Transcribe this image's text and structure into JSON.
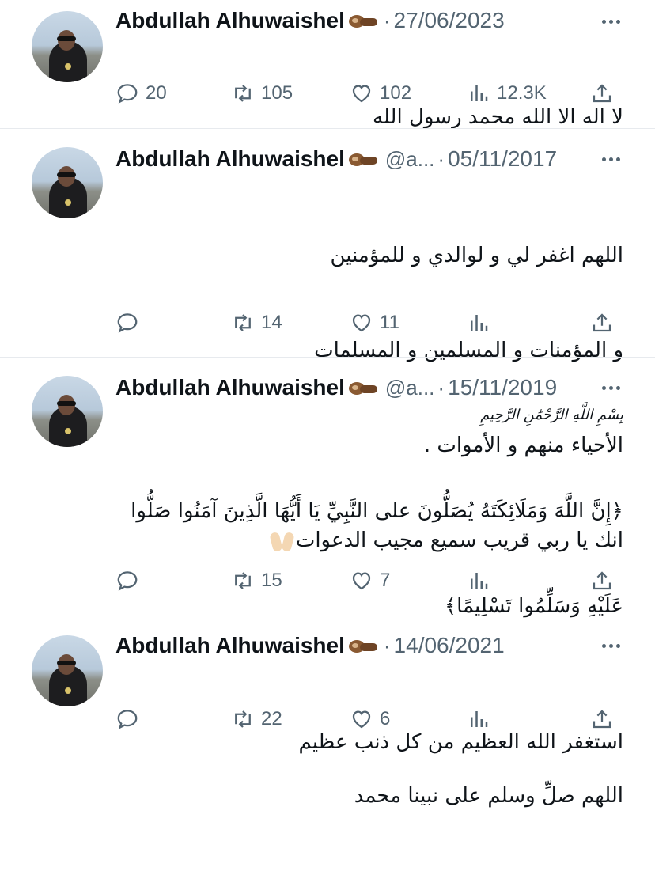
{
  "tweets": [
    {
      "name": "Abdullah Alhuwaishel",
      "handle": "",
      "date": "27/06/2023",
      "lines": [
        "لا اله الا الله محمد رسول الله"
      ],
      "replies": "20",
      "retweets": "105",
      "likes": "102",
      "views": "12.3K"
    },
    {
      "name": "Abdullah Alhuwaishel",
      "handle": "@a...",
      "date": "05/11/2017",
      "lines": [
        "اللهم اغفر لي و لوالدي و للمؤمنين",
        "و المؤمنات و المسلمين و المسلمات",
        "الأحياء منهم و الأموات .",
        "انك يا ربي قريب سميع مجيب الدعوات"
      ],
      "replies": "",
      "retweets": "14",
      "likes": "11",
      "views": ""
    },
    {
      "name": "Abdullah Alhuwaishel",
      "handle": "@a...",
      "date": "15/11/2019",
      "bismillah": "بِسْمِ اللَّهِ الرَّحْمَٰنِ الرَّحِيمِ",
      "lines": [
        "﴿إِنَّ اللَّهَ وَمَلَائِكَتَهُ يُصَلُّونَ على النَّبِيِّ يَا أَيُّهَا الَّذِينَ آمَنُوا صَلُّوا",
        "عَلَيْهِ وَسَلِّمُوا تَسْلِيمًا﴾",
        "",
        "اللهم صلِّ وسلم على نبينا محمد"
      ],
      "replies": "",
      "retweets": "15",
      "likes": "7",
      "views": ""
    },
    {
      "name": "Abdullah Alhuwaishel",
      "handle": "",
      "date": "14/06/2021",
      "lines": [
        "استغفر الله العظيم من كل ذنب عظيم"
      ],
      "replies": "",
      "retweets": "22",
      "likes": "6",
      "views": ""
    }
  ],
  "icons": {
    "reply": "reply-icon",
    "retweet": "retweet-icon",
    "like": "like-icon",
    "views": "views-icon",
    "share": "share-icon",
    "more": "more-icon"
  },
  "colors": {
    "text": "#0f1419",
    "muted": "#536471",
    "separator": "#e7eaee"
  }
}
